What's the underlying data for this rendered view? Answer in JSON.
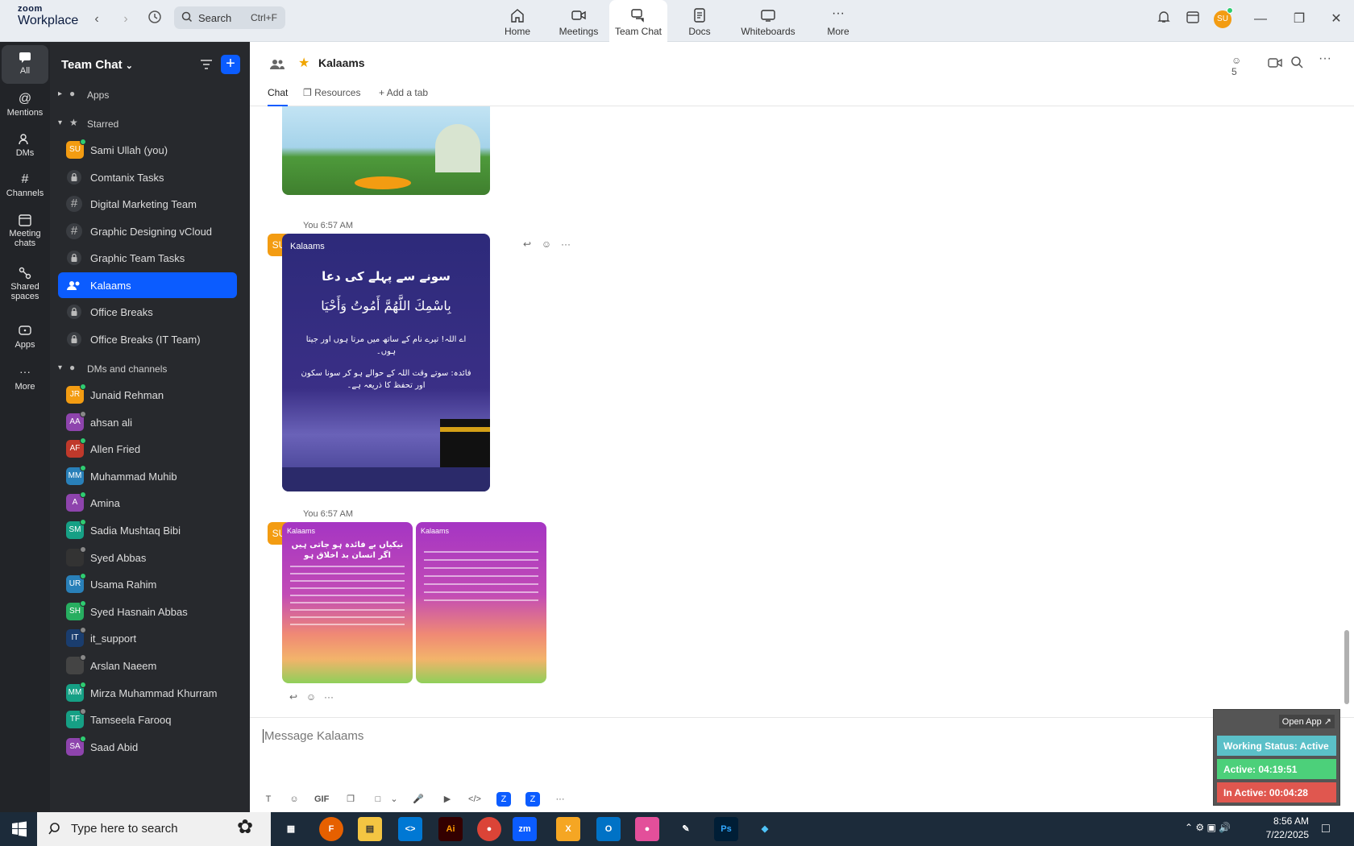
{
  "app": {
    "brand_top": "zoom",
    "brand_bottom": "Workplace"
  },
  "search": {
    "label": "Search",
    "shortcut": "Ctrl+F"
  },
  "nav_tabs": [
    {
      "label": "Home",
      "icon": "home-icon"
    },
    {
      "label": "Meetings",
      "icon": "video-icon"
    },
    {
      "label": "Team Chat",
      "icon": "chat-icon",
      "active": true
    },
    {
      "label": "Docs",
      "icon": "doc-icon"
    },
    {
      "label": "Whiteboards",
      "icon": "whiteboard-icon"
    },
    {
      "label": "More",
      "icon": "more-icon"
    }
  ],
  "user_avatar": "SU",
  "rail": [
    {
      "label": "All",
      "icon": "chat-bubble-icon",
      "active": true
    },
    {
      "label": "Mentions",
      "icon": "at-icon"
    },
    {
      "label": "DMs",
      "icon": "people-icon"
    },
    {
      "label": "Channels",
      "icon": "hash-icon"
    },
    {
      "label": "Meeting chats",
      "icon": "calendar-icon"
    },
    {
      "label": "Shared spaces",
      "icon": "share-icon"
    },
    {
      "label": "Apps",
      "icon": "apps-icon"
    },
    {
      "label": "More",
      "icon": "more-icon"
    }
  ],
  "sidebar": {
    "title": "Team Chat",
    "apps_label": "Apps",
    "starred_label": "Starred",
    "starred": [
      {
        "label": "Sami Ullah (you)",
        "type": "avatar",
        "initials": "SU",
        "color": "#f39c12",
        "presence": "on"
      },
      {
        "label": "Comtanix Tasks",
        "type": "lock"
      },
      {
        "label": "Digital Marketing Team",
        "type": "hash"
      },
      {
        "label": "Graphic Designing vCloud",
        "type": "hash"
      },
      {
        "label": "Graphic Team Tasks",
        "type": "lock"
      },
      {
        "label": "Kalaams",
        "type": "group",
        "active": true
      },
      {
        "label": "Office Breaks",
        "type": "lock"
      },
      {
        "label": "Office Breaks (IT Team)",
        "type": "lock"
      }
    ],
    "dms_label": "DMs and channels",
    "dms": [
      {
        "label": "Junaid Rehman",
        "initials": "JR",
        "color": "#f39c12",
        "presence": "on"
      },
      {
        "label": "ahsan ali",
        "initials": "AA",
        "color": "#8e44ad",
        "presence": "off"
      },
      {
        "label": "Allen Fried",
        "initials": "AF",
        "color": "#c0392b",
        "presence": "on"
      },
      {
        "label": "Muhammad Muhib",
        "initials": "MM",
        "color": "#2980b9",
        "presence": "on"
      },
      {
        "label": "Amina",
        "initials": "A",
        "color": "#8e44ad",
        "presence": "on"
      },
      {
        "label": "Sadia Mushtaq Bibi",
        "initials": "SM",
        "color": "#16a085",
        "presence": "on"
      },
      {
        "label": "Syed Abbas",
        "initials": "",
        "color": "#333333",
        "presence": "off"
      },
      {
        "label": "Usama Rahim",
        "initials": "UR",
        "color": "#2980b9",
        "presence": "on"
      },
      {
        "label": "Syed Hasnain Abbas",
        "initials": "SH",
        "color": "#27ae60",
        "presence": "on"
      },
      {
        "label": "it_support",
        "initials": "IT",
        "color": "#1a3d6e",
        "presence": "off"
      },
      {
        "label": "Arslan Naeem",
        "initials": "",
        "color": "#444444",
        "presence": "off"
      },
      {
        "label": "Mirza Muhammad Khurram",
        "initials": "MM",
        "color": "#16a085",
        "presence": "on"
      },
      {
        "label": "Tamseela Farooq",
        "initials": "TF",
        "color": "#16a085",
        "presence": "off"
      },
      {
        "label": "Saad Abid",
        "initials": "SA",
        "color": "#8e44ad",
        "presence": "on"
      }
    ]
  },
  "channel": {
    "name": "Kalaams",
    "member_count": "5",
    "tabs": [
      "Chat",
      "Resources",
      "Add a tab"
    ]
  },
  "messages": [
    {
      "sender": "You",
      "time": "6:57 AM",
      "avatar": "SU"
    },
    {
      "sender": "You",
      "time": "6:57 AM",
      "avatar": "SU"
    }
  ],
  "card1": {
    "brand": "Kalaams",
    "heading": "سونے سے پہلے کی دعا",
    "arabic": "بِاسْمِكَ اللَّهُمَّ أَمُوتُ وَأَحْيَا",
    "line1": "اے اللہ! تیرے نام کے ساتھ میں مرتا ہوں اور جیتا ہوں۔",
    "line2": "فائدہ: سوتے وقت اللہ کے حوالے ہو کر سونا سکون اور تحفظ کا ذریعہ ہے۔"
  },
  "card2": {
    "brand": "Kalaams",
    "heading": "نیکیاں بے فائدہ ہو جاتی ہیں اگر انسان بد اخلاق ہو"
  },
  "composer": {
    "placeholder": "Message Kalaams",
    "gif_label": "GIF"
  },
  "widget": {
    "open_label": "Open App ↗",
    "working": "Working Status: Active",
    "active": "Active: 04:19:51",
    "inactive": "In Active: 00:04:28",
    "colors": {
      "working": "#5bc0c8",
      "active": "#4cd07a",
      "inactive": "#e0574f"
    }
  },
  "taskbar": {
    "search_placeholder": "Type here to search",
    "time": "8:56 AM",
    "date": "7/22/2025"
  }
}
